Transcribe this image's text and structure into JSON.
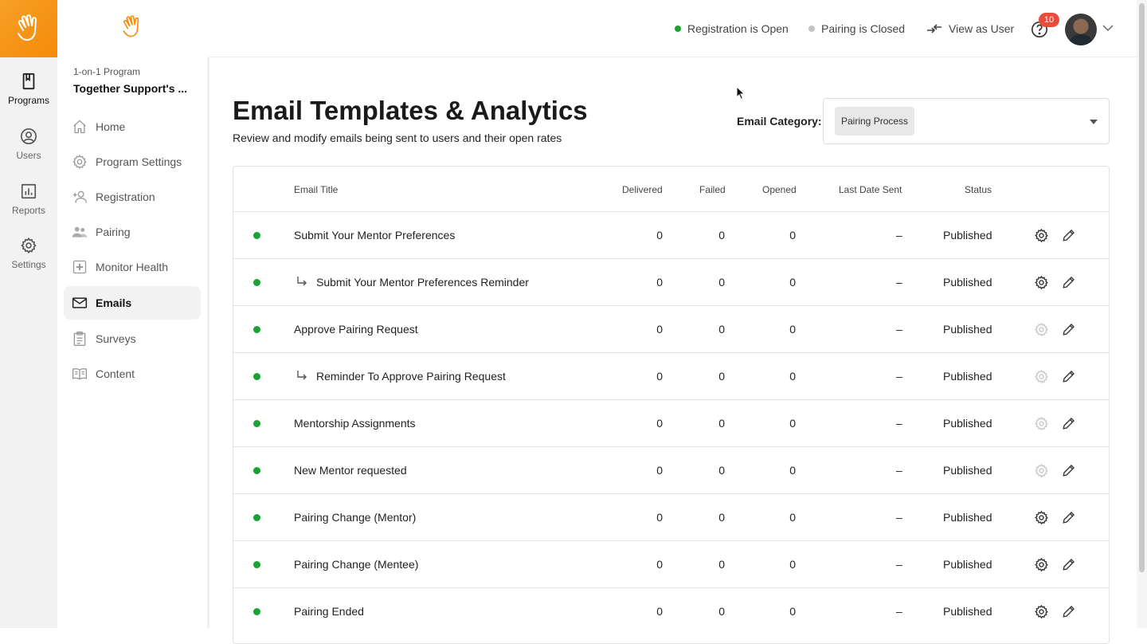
{
  "rail": {
    "items": [
      {
        "label": "Programs",
        "icon": "book-icon"
      },
      {
        "label": "Users",
        "icon": "user-circle-icon"
      },
      {
        "label": "Reports",
        "icon": "chart-icon"
      },
      {
        "label": "Settings",
        "icon": "gear-icon"
      }
    ]
  },
  "program": {
    "type": "1-on-1 Program",
    "name": "Together Support's ..."
  },
  "nav": [
    {
      "label": "Home",
      "icon": "home-icon"
    },
    {
      "label": "Program Settings",
      "icon": "gear-icon"
    },
    {
      "label": "Registration",
      "icon": "add-user-icon"
    },
    {
      "label": "Pairing",
      "icon": "users-icon"
    },
    {
      "label": "Monitor Health",
      "icon": "plus-square-icon"
    },
    {
      "label": "Emails",
      "icon": "mail-icon"
    },
    {
      "label": "Surveys",
      "icon": "clipboard-icon"
    },
    {
      "label": "Content",
      "icon": "open-book-icon"
    }
  ],
  "topbar": {
    "registration": "Registration is Open",
    "pairing": "Pairing is Closed",
    "view_as_user": "View as User",
    "notifications": "10",
    "colors": {
      "open": "#1aa332",
      "closed": "#c4c4c4",
      "badge": "#e74c3c"
    }
  },
  "header": {
    "title": "Email Templates & Analytics",
    "subtitle": "Review and modify emails being sent to users and their open rates",
    "category_label": "Email Category:",
    "category_value": "Pairing Process"
  },
  "table": {
    "columns": {
      "title": "Email Title",
      "delivered": "Delivered",
      "failed": "Failed",
      "opened": "Opened",
      "last_sent": "Last Date Sent",
      "status": "Status"
    },
    "rows": [
      {
        "title": "Submit Your Mentor Preferences",
        "sub": false,
        "delivered": "0",
        "failed": "0",
        "opened": "0",
        "last_sent": "–",
        "status": "Published",
        "settings_enabled": true
      },
      {
        "title": "Submit Your Mentor Preferences Reminder",
        "sub": true,
        "delivered": "0",
        "failed": "0",
        "opened": "0",
        "last_sent": "–",
        "status": "Published",
        "settings_enabled": true
      },
      {
        "title": "Approve Pairing Request",
        "sub": false,
        "delivered": "0",
        "failed": "0",
        "opened": "0",
        "last_sent": "–",
        "status": "Published",
        "settings_enabled": false
      },
      {
        "title": "Reminder To Approve Pairing Request",
        "sub": true,
        "delivered": "0",
        "failed": "0",
        "opened": "0",
        "last_sent": "–",
        "status": "Published",
        "settings_enabled": false
      },
      {
        "title": "Mentorship Assignments",
        "sub": false,
        "delivered": "0",
        "failed": "0",
        "opened": "0",
        "last_sent": "–",
        "status": "Published",
        "settings_enabled": false
      },
      {
        "title": "New Mentor requested",
        "sub": false,
        "delivered": "0",
        "failed": "0",
        "opened": "0",
        "last_sent": "–",
        "status": "Published",
        "settings_enabled": false
      },
      {
        "title": "Pairing Change (Mentor)",
        "sub": false,
        "delivered": "0",
        "failed": "0",
        "opened": "0",
        "last_sent": "–",
        "status": "Published",
        "settings_enabled": true
      },
      {
        "title": "Pairing Change (Mentee)",
        "sub": false,
        "delivered": "0",
        "failed": "0",
        "opened": "0",
        "last_sent": "–",
        "status": "Published",
        "settings_enabled": true
      },
      {
        "title": "Pairing Ended",
        "sub": false,
        "delivered": "0",
        "failed": "0",
        "opened": "0",
        "last_sent": "–",
        "status": "Published",
        "settings_enabled": true
      }
    ]
  }
}
